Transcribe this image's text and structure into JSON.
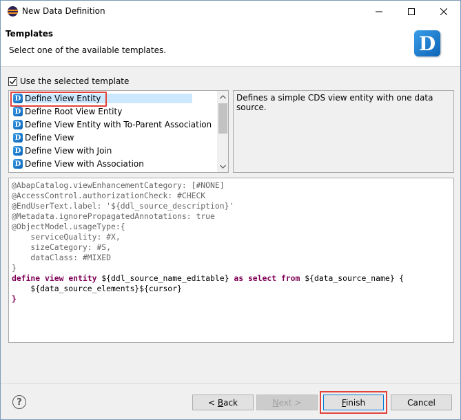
{
  "window": {
    "title": "New Data Definition"
  },
  "header": {
    "title": "Templates",
    "subtitle": "Select one of the available templates."
  },
  "logo_letter": "D",
  "use_template": {
    "label": "Use the selected template",
    "checked": true
  },
  "templates": {
    "items": [
      {
        "label": "Define View Entity"
      },
      {
        "label": "Define Root View Entity"
      },
      {
        "label": "Define View Entity with To-Parent Association"
      },
      {
        "label": "Define View"
      },
      {
        "label": "Define View with Join"
      },
      {
        "label": "Define View with Association"
      }
    ],
    "selected_index": 0
  },
  "description": "Defines a simple CDS view entity with one data source.",
  "preview": {
    "lines": [
      "@AbapCatalog.viewEnhancementCategory: [#NONE]",
      "@AccessControl.authorizationCheck: #CHECK",
      "@EndUserText.label: '${ddl_source_description}'",
      "@Metadata.ignorePropagatedAnnotations: true",
      "@ObjectModel.usageType:{",
      "    serviceQuality: #X,",
      "    sizeCategory: #S,",
      "    dataClass: #MIXED",
      "}",
      "define view entity ${ddl_source_name_editable} as select from ${data_source_name} {",
      "    ${data_source_elements}${cursor}",
      "}"
    ]
  },
  "footer": {
    "help_label": "?",
    "back_label": "< Back",
    "next_label": "Next >",
    "finish_label": "Finish",
    "cancel_label": "Cancel"
  },
  "colors": {
    "highlight": "#e0443c",
    "selection": "#cce8ff",
    "keyword": "#7f0055",
    "annotation": "#646464"
  }
}
